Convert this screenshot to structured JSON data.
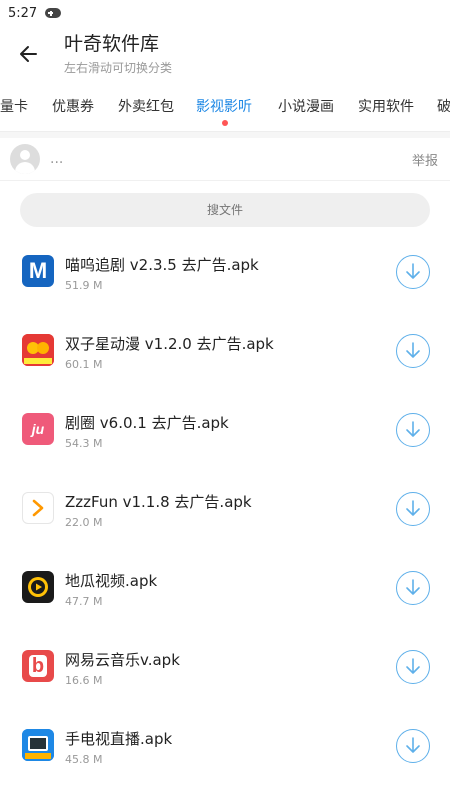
{
  "status": {
    "time": "5:27",
    "icon": "gamepad-icon"
  },
  "header": {
    "title": "叶奇软件库",
    "subtitle": "左右滑动可切换分类"
  },
  "tabs": [
    {
      "label": "量卡"
    },
    {
      "label": "优惠券"
    },
    {
      "label": "外卖红包"
    },
    {
      "label": "影视影听",
      "active": true
    },
    {
      "label": "小说漫画"
    },
    {
      "label": "实用软件"
    },
    {
      "label": "破"
    }
  ],
  "colors": {
    "accent": "#1e88e5",
    "download": "#5fb0ea",
    "tab_dot": "#ff5555"
  },
  "user": {
    "name": "...",
    "report_label": "举报"
  },
  "search": {
    "placeholder": "搜文件"
  },
  "files": [
    {
      "name": "喵呜追剧 v2.3.5 去广告.apk",
      "size": "51.9 M",
      "icon": "miaowu-app-icon",
      "icon_text": "M"
    },
    {
      "name": "双子星动漫 v1.2.0 去广告.apk",
      "size": "60.1 M",
      "icon": "shuangzixing-app-icon",
      "icon_text": ""
    },
    {
      "name": "剧圈 v6.0.1 去广告.apk",
      "size": "54.3 M",
      "icon": "juquan-app-icon",
      "icon_text": "ju"
    },
    {
      "name": "ZzzFun v1.1.8 去广告.apk",
      "size": "22.0 M",
      "icon": "zzzfun-app-icon",
      "icon_text": ""
    },
    {
      "name": "地瓜视频.apk",
      "size": "47.7 M",
      "icon": "digua-app-icon",
      "icon_text": ""
    },
    {
      "name": "网易云音乐v.apk",
      "size": "16.6 M",
      "icon": "netease-music-app-icon",
      "icon_text": "b"
    },
    {
      "name": "手电视直播.apk",
      "size": "45.8 M",
      "icon": "tv-live-app-icon",
      "icon_text": ""
    }
  ]
}
